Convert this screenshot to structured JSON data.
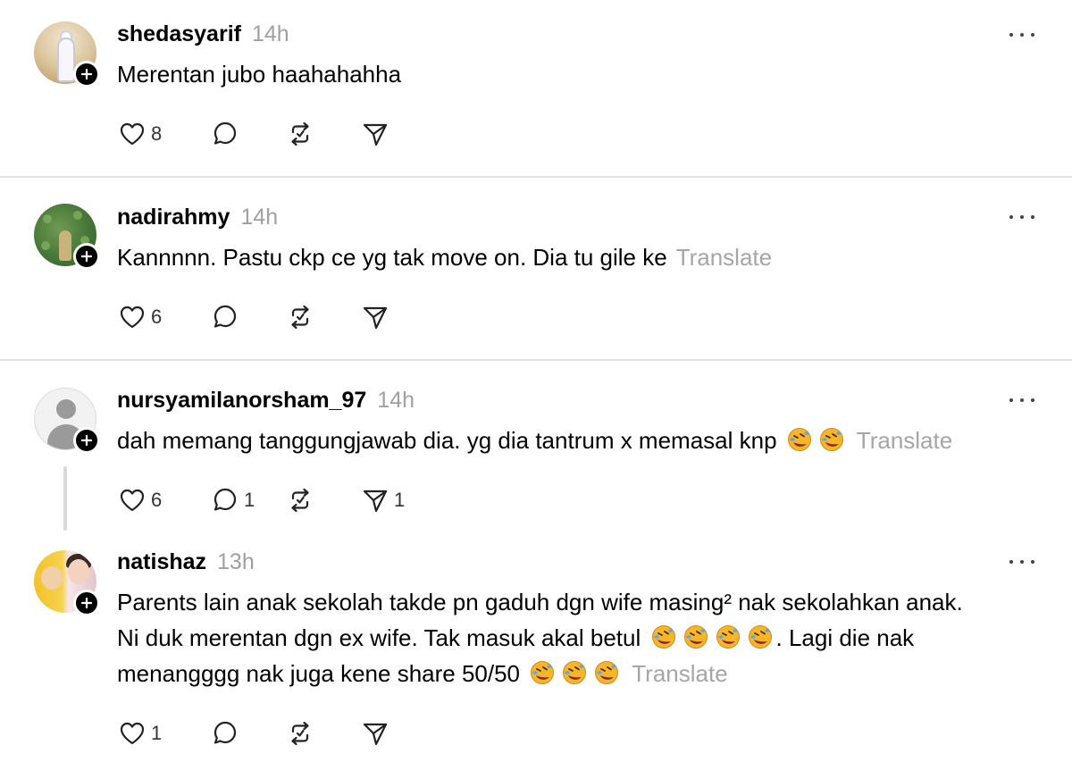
{
  "posts": [
    {
      "username": "shedasyarif",
      "time": "14h",
      "text": "Merentan jubo haahahahha",
      "translate": "",
      "likes": "8",
      "replies": "",
      "reposts": "",
      "shares": ""
    },
    {
      "username": "nadirahmy",
      "time": "14h",
      "text": "Kannnnn. Pastu ckp ce yg tak move on. Dia tu gile ke",
      "translate": "Translate",
      "likes": "6",
      "replies": "",
      "reposts": "",
      "shares": ""
    },
    {
      "username": "nursyamilanorsham_97",
      "time": "14h",
      "text": "dah memang tanggungjawab dia. yg dia tantrum x memasal knp",
      "translate": "Translate",
      "likes": "6",
      "replies": "1",
      "reposts": "",
      "shares": "1"
    },
    {
      "username": "natishaz",
      "time": "13h",
      "line1": "Parents lain anak sekolah takde pn gaduh dgn wife masing² nak sekolahkan anak.",
      "line2a": "Ni duk merentan dgn ex wife. Tak masuk akal betul",
      "line2b": ". Lagi die nak",
      "line3": "menangggg nak juga kene share 50/50",
      "translate": "Translate",
      "likes": "1",
      "replies": "",
      "reposts": "",
      "shares": ""
    }
  ],
  "icons": {
    "emoji": "rolling-on-the-floor-laughing",
    "like": "heart-icon",
    "reply": "comment-icon",
    "repost": "repost-icon",
    "share": "send-icon",
    "follow": "plus-icon",
    "more": "more-icon"
  },
  "colors": {
    "muted": "#a0a0a0",
    "divider": "#e3e3e3",
    "badge": "#000000"
  }
}
